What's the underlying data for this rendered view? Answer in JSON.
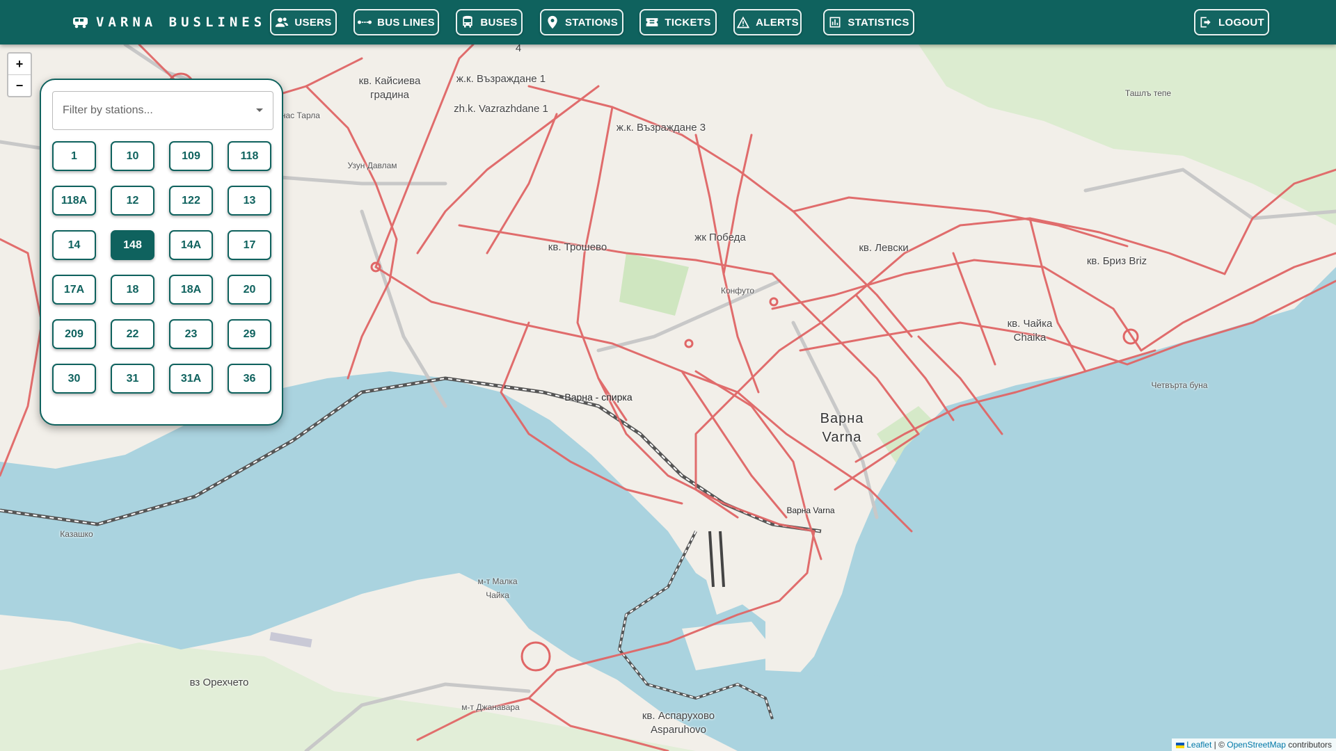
{
  "brand": {
    "title": "VARNA BUSLINES"
  },
  "nav": {
    "users": "USERS",
    "bus_lines": "BUS LINES",
    "buses": "BUSES",
    "stations": "STATIONS",
    "tickets": "TICKETS",
    "alerts": "ALERTS",
    "statistics": "STATISTICS",
    "logout": "LOGOUT"
  },
  "zoom": {
    "in": "+",
    "out": "−"
  },
  "filter": {
    "placeholder": "Filter by stations...",
    "lines": [
      "1",
      "10",
      "109",
      "118",
      "118A",
      "12",
      "122",
      "13",
      "14",
      "148",
      "14A",
      "17",
      "17A",
      "18",
      "18A",
      "20",
      "209",
      "22",
      "23",
      "29",
      "30",
      "31",
      "31A",
      "36"
    ],
    "selected": "148"
  },
  "map": {
    "places": {
      "kaysieva": "кв. Кайсиева градина",
      "vazrazhdane1": "ж.к. Възраждане 1",
      "vazrazhdane1_lat": "zh.k. Vazrazhdane 1",
      "vazrazhdane3": "ж.к. Възраждане 3",
      "vazrazhdane4": "4",
      "atanas": "Атанас Тарла",
      "uzun": "Узун Давлам",
      "troshevo": "кв. Трошево",
      "pobeda": "жк Победа",
      "konfuto": "Конфуто",
      "levski": "кв. Левски",
      "briz": "кв. Бриз Briz",
      "chaika": "кв. Чайка Chaika",
      "tashla": "Ташлъ тепе",
      "chetvarta": "Четвърта буна",
      "spirka": "Варна - спирка",
      "varna_bg": "Варна",
      "varna_lat": "Varna",
      "varna_station": "Варна Varna",
      "kazashko": "Казашко",
      "malka_chaika": "м-т Малка Чайка",
      "orehcheto": "вз Орехчето",
      "dzhanavara": "м-т Джанавара",
      "asparuhovo": "кв. Аспарухово Asparuhovo"
    }
  },
  "attribution": {
    "leaflet": "Leaflet",
    "sep": " | © ",
    "osm": "OpenStreetMap",
    "contrib": " contributors"
  },
  "colors": {
    "primary": "#0f625e",
    "route": "#e06666",
    "water": "#aad3df"
  }
}
